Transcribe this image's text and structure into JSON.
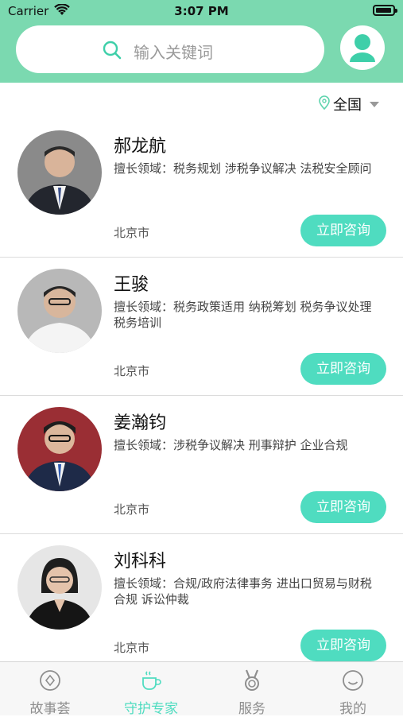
{
  "status_bar": {
    "carrier": "Carrier",
    "time": "3:07 PM"
  },
  "header": {
    "search_placeholder": "输入关键词",
    "icons": {
      "search": "search-icon",
      "profile": "user-avatar-icon"
    }
  },
  "region": {
    "label": "全国",
    "icon": "location-pin-icon"
  },
  "experts": [
    {
      "name": "郝龙航",
      "fields": "擅长领域：税务规划 涉税争议解决 法税安全顾问",
      "city": "北京市",
      "button": "立即咨询"
    },
    {
      "name": "王骏",
      "fields": "擅长领域：税务政策适用 纳税筹划 税务争议处理 税务培训",
      "city": "北京市",
      "button": "立即咨询"
    },
    {
      "name": "姜瀚钧",
      "fields": "擅长领域：涉税争议解决 刑事辩护 企业合规",
      "city": "北京市",
      "button": "立即咨询"
    },
    {
      "name": "刘科科",
      "fields": "擅长领域：合规/政府法律事务 进出口贸易与财税合规 诉讼仲裁",
      "city": "北京市",
      "button": "立即咨询"
    }
  ],
  "tabs": [
    {
      "label": "故事荟",
      "icon": "compass-icon",
      "active": false
    },
    {
      "label": "守护专家",
      "icon": "coffee-cup-icon",
      "active": true
    },
    {
      "label": "服务",
      "icon": "medal-icon",
      "active": false
    },
    {
      "label": "我的",
      "icon": "smiley-icon",
      "active": false
    }
  ],
  "colors": {
    "header_bg": "#7bd9b0",
    "accent": "#4fdcc0",
    "tab_inactive": "#8e8e8e"
  }
}
